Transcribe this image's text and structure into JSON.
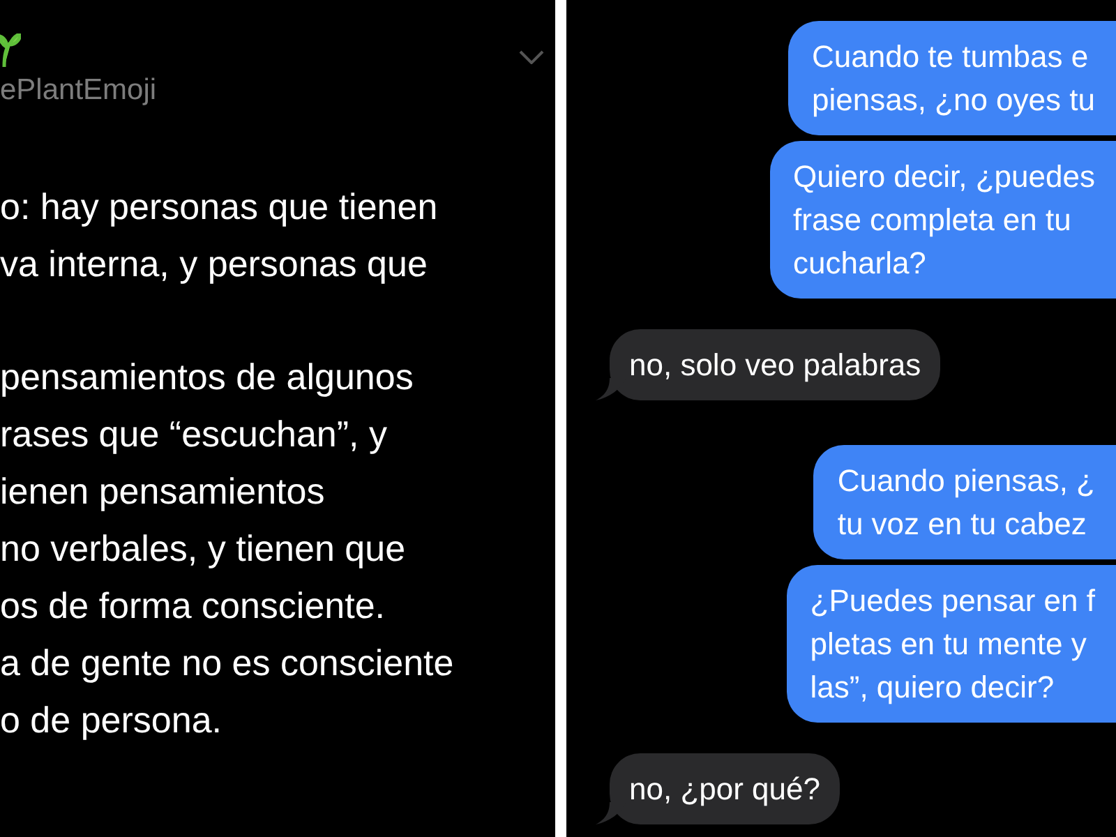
{
  "tweet": {
    "handle": "ePlantEmoji",
    "paragraphs": [
      [
        "o: hay personas que tienen",
        "va interna, y personas que"
      ],
      [
        "pensamientos de algunos",
        "rases que “escuchan”, y",
        "ienen pensamientos",
        "no verbales, y tienen que",
        "os de forma consciente.",
        "a de gente no es consciente",
        "o de persona."
      ]
    ]
  },
  "messages": [
    {
      "kind": "sent",
      "lines": [
        "Cuando te tumbas e",
        "piensas, ¿no oyes tu"
      ]
    },
    {
      "kind": "sent",
      "lines": [
        "Quiero decir, ¿puedes",
        "frase completa en tu",
        "cucharla?"
      ]
    },
    {
      "kind": "received",
      "lines": [
        "no, solo veo palabras"
      ]
    },
    {
      "kind": "sent",
      "lines": [
        "Cuando piensas, ¿",
        "tu voz en tu cabez"
      ]
    },
    {
      "kind": "sent",
      "lines": [
        "¿Puedes pensar en f",
        "pletas en tu mente y",
        "las”, quiero decir?"
      ]
    },
    {
      "kind": "received",
      "lines": [
        "no, ¿por qué?"
      ]
    }
  ]
}
